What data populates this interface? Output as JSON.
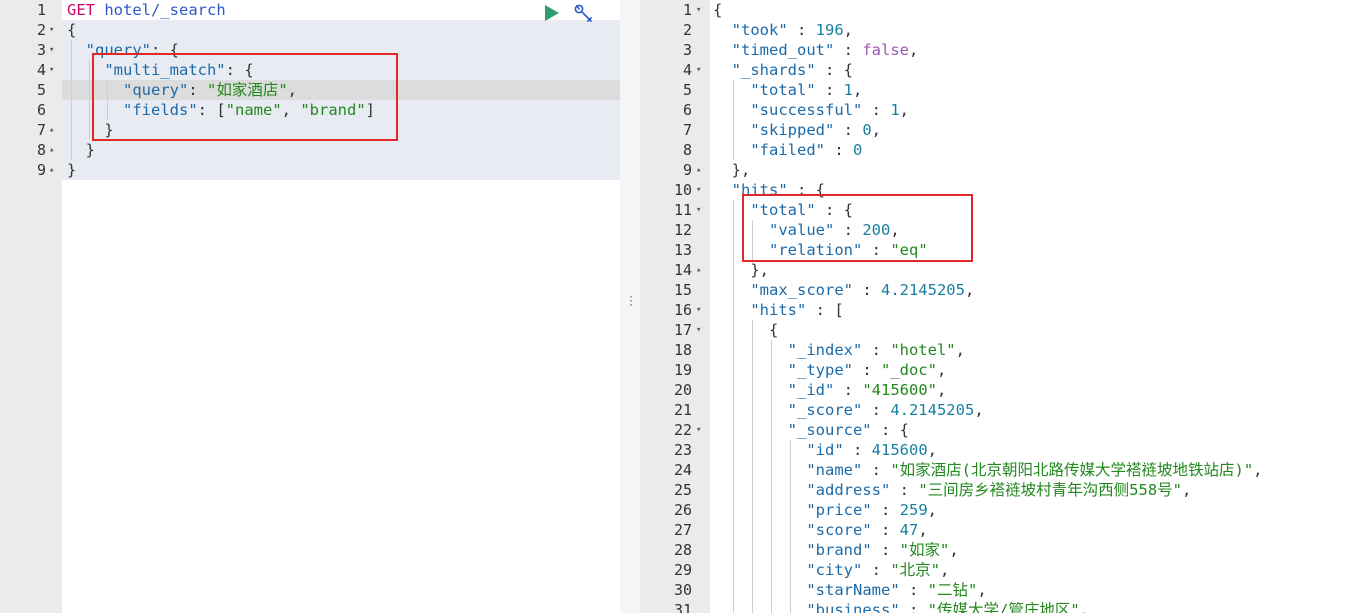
{
  "request_editor": {
    "run_icon": "play-icon",
    "settings_icon": "wrench-icon",
    "lines": [
      {
        "n": "1",
        "fold": "",
        "tokens": [
          [
            "method",
            "GET"
          ],
          [
            "punc",
            " "
          ],
          [
            "url",
            "hotel/_search"
          ]
        ]
      },
      {
        "n": "2",
        "fold": "▾",
        "tokens": [
          [
            "punc",
            "{"
          ]
        ]
      },
      {
        "n": "3",
        "fold": "▾",
        "tokens": [
          [
            "punc",
            "  "
          ],
          [
            "key",
            "\"query\""
          ],
          [
            "punc",
            ": {"
          ]
        ]
      },
      {
        "n": "4",
        "fold": "▾",
        "tokens": [
          [
            "punc",
            "    "
          ],
          [
            "key",
            "\"multi_match\""
          ],
          [
            "punc",
            ": {"
          ]
        ]
      },
      {
        "n": "5",
        "fold": "",
        "tokens": [
          [
            "punc",
            "      "
          ],
          [
            "key",
            "\"query\""
          ],
          [
            "punc",
            ": "
          ],
          [
            "str",
            "\"如家酒店\""
          ],
          [
            "punc",
            ","
          ]
        ]
      },
      {
        "n": "6",
        "fold": "",
        "tokens": [
          [
            "punc",
            "      "
          ],
          [
            "key",
            "\"fields\""
          ],
          [
            "punc",
            ": ["
          ],
          [
            "str",
            "\"name\""
          ],
          [
            "punc",
            ", "
          ],
          [
            "str",
            "\"brand\""
          ],
          [
            "punc",
            "]"
          ]
        ]
      },
      {
        "n": "7",
        "fold": "▴",
        "tokens": [
          [
            "punc",
            "    }"
          ]
        ]
      },
      {
        "n": "8",
        "fold": "▴",
        "tokens": [
          [
            "punc",
            "  }"
          ]
        ]
      },
      {
        "n": "9",
        "fold": "▴",
        "tokens": [
          [
            "punc",
            "}"
          ]
        ]
      }
    ]
  },
  "response_viewer": {
    "lines": [
      {
        "n": "1",
        "fold": "▾",
        "tokens": [
          [
            "punc",
            "{"
          ]
        ]
      },
      {
        "n": "2",
        "fold": "",
        "tokens": [
          [
            "punc",
            "  "
          ],
          [
            "key",
            "\"took\""
          ],
          [
            "punc",
            " : "
          ],
          [
            "num",
            "196"
          ],
          [
            "punc",
            ","
          ]
        ]
      },
      {
        "n": "3",
        "fold": "",
        "tokens": [
          [
            "punc",
            "  "
          ],
          [
            "key",
            "\"timed_out\""
          ],
          [
            "punc",
            " : "
          ],
          [
            "bool",
            "false"
          ],
          [
            "punc",
            ","
          ]
        ]
      },
      {
        "n": "4",
        "fold": "▾",
        "tokens": [
          [
            "punc",
            "  "
          ],
          [
            "key",
            "\"_shards\""
          ],
          [
            "punc",
            " : {"
          ]
        ]
      },
      {
        "n": "5",
        "fold": "",
        "tokens": [
          [
            "punc",
            "    "
          ],
          [
            "key",
            "\"total\""
          ],
          [
            "punc",
            " : "
          ],
          [
            "num",
            "1"
          ],
          [
            "punc",
            ","
          ]
        ]
      },
      {
        "n": "6",
        "fold": "",
        "tokens": [
          [
            "punc",
            "    "
          ],
          [
            "key",
            "\"successful\""
          ],
          [
            "punc",
            " : "
          ],
          [
            "num",
            "1"
          ],
          [
            "punc",
            ","
          ]
        ]
      },
      {
        "n": "7",
        "fold": "",
        "tokens": [
          [
            "punc",
            "    "
          ],
          [
            "key",
            "\"skipped\""
          ],
          [
            "punc",
            " : "
          ],
          [
            "num",
            "0"
          ],
          [
            "punc",
            ","
          ]
        ]
      },
      {
        "n": "8",
        "fold": "",
        "tokens": [
          [
            "punc",
            "    "
          ],
          [
            "key",
            "\"failed\""
          ],
          [
            "punc",
            " : "
          ],
          [
            "num",
            "0"
          ]
        ]
      },
      {
        "n": "9",
        "fold": "▴",
        "tokens": [
          [
            "punc",
            "  },"
          ]
        ]
      },
      {
        "n": "10",
        "fold": "▾",
        "tokens": [
          [
            "punc",
            "  "
          ],
          [
            "key",
            "\"hits\""
          ],
          [
            "punc",
            " : {"
          ]
        ]
      },
      {
        "n": "11",
        "fold": "▾",
        "tokens": [
          [
            "punc",
            "    "
          ],
          [
            "key",
            "\"total\""
          ],
          [
            "punc",
            " : {"
          ]
        ]
      },
      {
        "n": "12",
        "fold": "",
        "tokens": [
          [
            "punc",
            "      "
          ],
          [
            "key",
            "\"value\""
          ],
          [
            "punc",
            " : "
          ],
          [
            "num",
            "200"
          ],
          [
            "punc",
            ","
          ]
        ]
      },
      {
        "n": "13",
        "fold": "",
        "tokens": [
          [
            "punc",
            "      "
          ],
          [
            "key",
            "\"relation\""
          ],
          [
            "punc",
            " : "
          ],
          [
            "str",
            "\"eq\""
          ]
        ]
      },
      {
        "n": "14",
        "fold": "▴",
        "tokens": [
          [
            "punc",
            "    },"
          ]
        ]
      },
      {
        "n": "15",
        "fold": "",
        "tokens": [
          [
            "punc",
            "    "
          ],
          [
            "key",
            "\"max_score\""
          ],
          [
            "punc",
            " : "
          ],
          [
            "num",
            "4.2145205"
          ],
          [
            "punc",
            ","
          ]
        ]
      },
      {
        "n": "16",
        "fold": "▾",
        "tokens": [
          [
            "punc",
            "    "
          ],
          [
            "key",
            "\"hits\""
          ],
          [
            "punc",
            " : ["
          ]
        ]
      },
      {
        "n": "17",
        "fold": "▾",
        "tokens": [
          [
            "punc",
            "      {"
          ]
        ]
      },
      {
        "n": "18",
        "fold": "",
        "tokens": [
          [
            "punc",
            "        "
          ],
          [
            "key",
            "\"_index\""
          ],
          [
            "punc",
            " : "
          ],
          [
            "str",
            "\"hotel\""
          ],
          [
            "punc",
            ","
          ]
        ]
      },
      {
        "n": "19",
        "fold": "",
        "tokens": [
          [
            "punc",
            "        "
          ],
          [
            "key",
            "\"_type\""
          ],
          [
            "punc",
            " : "
          ],
          [
            "str",
            "\"_doc\""
          ],
          [
            "punc",
            ","
          ]
        ]
      },
      {
        "n": "20",
        "fold": "",
        "tokens": [
          [
            "punc",
            "        "
          ],
          [
            "key",
            "\"_id\""
          ],
          [
            "punc",
            " : "
          ],
          [
            "str",
            "\"415600\""
          ],
          [
            "punc",
            ","
          ]
        ]
      },
      {
        "n": "21",
        "fold": "",
        "tokens": [
          [
            "punc",
            "        "
          ],
          [
            "key",
            "\"_score\""
          ],
          [
            "punc",
            " : "
          ],
          [
            "num",
            "4.2145205"
          ],
          [
            "punc",
            ","
          ]
        ]
      },
      {
        "n": "22",
        "fold": "▾",
        "tokens": [
          [
            "punc",
            "        "
          ],
          [
            "key",
            "\"_source\""
          ],
          [
            "punc",
            " : {"
          ]
        ]
      },
      {
        "n": "23",
        "fold": "",
        "tokens": [
          [
            "punc",
            "          "
          ],
          [
            "key",
            "\"id\""
          ],
          [
            "punc",
            " : "
          ],
          [
            "num",
            "415600"
          ],
          [
            "punc",
            ","
          ]
        ]
      },
      {
        "n": "24",
        "fold": "",
        "tokens": [
          [
            "punc",
            "          "
          ],
          [
            "key",
            "\"name\""
          ],
          [
            "punc",
            " : "
          ],
          [
            "str",
            "\"如家酒店(北京朝阳北路传媒大学褡裢坡地铁站店)\""
          ],
          [
            "punc",
            ","
          ]
        ]
      },
      {
        "n": "25",
        "fold": "",
        "tokens": [
          [
            "punc",
            "          "
          ],
          [
            "key",
            "\"address\""
          ],
          [
            "punc",
            " : "
          ],
          [
            "str",
            "\"三间房乡褡裢坡村青年沟西侧558号\""
          ],
          [
            "punc",
            ","
          ]
        ]
      },
      {
        "n": "26",
        "fold": "",
        "tokens": [
          [
            "punc",
            "          "
          ],
          [
            "key",
            "\"price\""
          ],
          [
            "punc",
            " : "
          ],
          [
            "num",
            "259"
          ],
          [
            "punc",
            ","
          ]
        ]
      },
      {
        "n": "27",
        "fold": "",
        "tokens": [
          [
            "punc",
            "          "
          ],
          [
            "key",
            "\"score\""
          ],
          [
            "punc",
            " : "
          ],
          [
            "num",
            "47"
          ],
          [
            "punc",
            ","
          ]
        ]
      },
      {
        "n": "28",
        "fold": "",
        "tokens": [
          [
            "punc",
            "          "
          ],
          [
            "key",
            "\"brand\""
          ],
          [
            "punc",
            " : "
          ],
          [
            "str",
            "\"如家\""
          ],
          [
            "punc",
            ","
          ]
        ]
      },
      {
        "n": "29",
        "fold": "",
        "tokens": [
          [
            "punc",
            "          "
          ],
          [
            "key",
            "\"city\""
          ],
          [
            "punc",
            " : "
          ],
          [
            "str",
            "\"北京\""
          ],
          [
            "punc",
            ","
          ]
        ]
      },
      {
        "n": "30",
        "fold": "",
        "tokens": [
          [
            "punc",
            "          "
          ],
          [
            "key",
            "\"starName\""
          ],
          [
            "punc",
            " : "
          ],
          [
            "str",
            "\"二钻\""
          ],
          [
            "punc",
            ","
          ]
        ]
      },
      {
        "n": "31",
        "fold": "",
        "tokens": [
          [
            "punc",
            "          "
          ],
          [
            "key",
            "\"business\""
          ],
          [
            "punc",
            " : "
          ],
          [
            "str",
            "\"传媒大学/管庄地区\""
          ],
          [
            "punc",
            ","
          ]
        ]
      }
    ]
  },
  "colors": {
    "highlight_box": "#e02828",
    "run_button": "#2e9e6f",
    "settings_button": "#2e58c7"
  }
}
